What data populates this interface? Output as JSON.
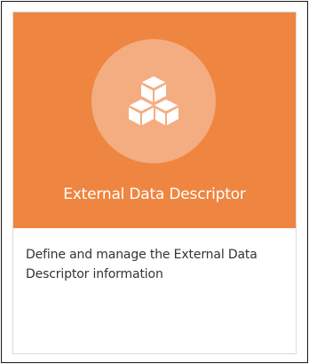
{
  "card": {
    "title": "External Data Descriptor",
    "description": "Define and manage the External Data Descriptor information",
    "icon": "cubes-icon",
    "colors": {
      "header_bg": "#ee8540",
      "icon_circle_bg": "#f4ad80",
      "icon_fg": "#ffffff",
      "title_text": "#ffffff",
      "body_text": "#333333"
    }
  }
}
